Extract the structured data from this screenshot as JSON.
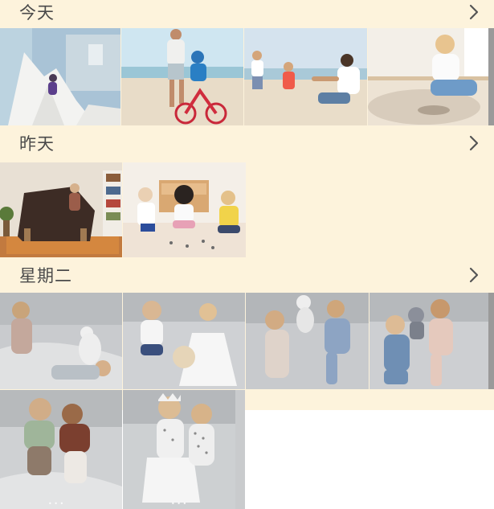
{
  "sections": [
    {
      "title": "今天",
      "photo_count": 4
    },
    {
      "title": "昨天",
      "photo_count": 2
    },
    {
      "title": "星期二",
      "photo_count": 6
    }
  ],
  "icons": {
    "expand": "chevron-right-icon"
  },
  "colors": {
    "header_bg": "#fdf3dc",
    "title_text": "#4a4a4a",
    "chevron": "#555555"
  }
}
